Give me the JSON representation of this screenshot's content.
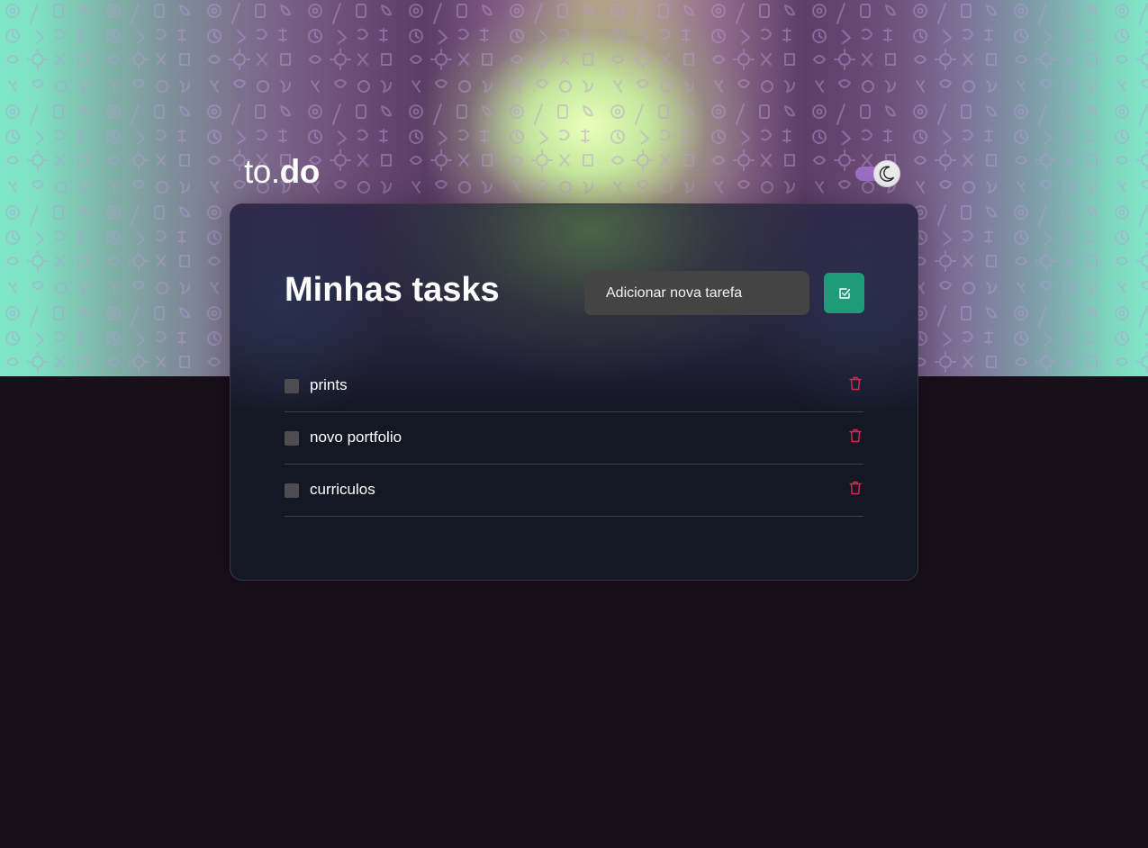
{
  "app": {
    "logo_prefix": "to.",
    "logo_suffix": "do",
    "theme_toggle_icon": "moon-icon"
  },
  "colors": {
    "accent": "#1e9b78",
    "delete": "#e0244f",
    "toggle_track": "#9b6fc4",
    "page_background": "#190f1b",
    "card_background": "#141724"
  },
  "main": {
    "title": "Minhas tasks",
    "new_task_input": {
      "placeholder": "Adicionar nova tarefa",
      "value": ""
    },
    "add_button_icon": "check-square-icon",
    "tasks": [
      {
        "label": "prints",
        "completed": false,
        "delete_icon": "trash-icon"
      },
      {
        "label": "novo portfolio",
        "completed": false,
        "delete_icon": "trash-icon"
      },
      {
        "label": "curriculos",
        "completed": false,
        "delete_icon": "trash-icon"
      }
    ]
  }
}
